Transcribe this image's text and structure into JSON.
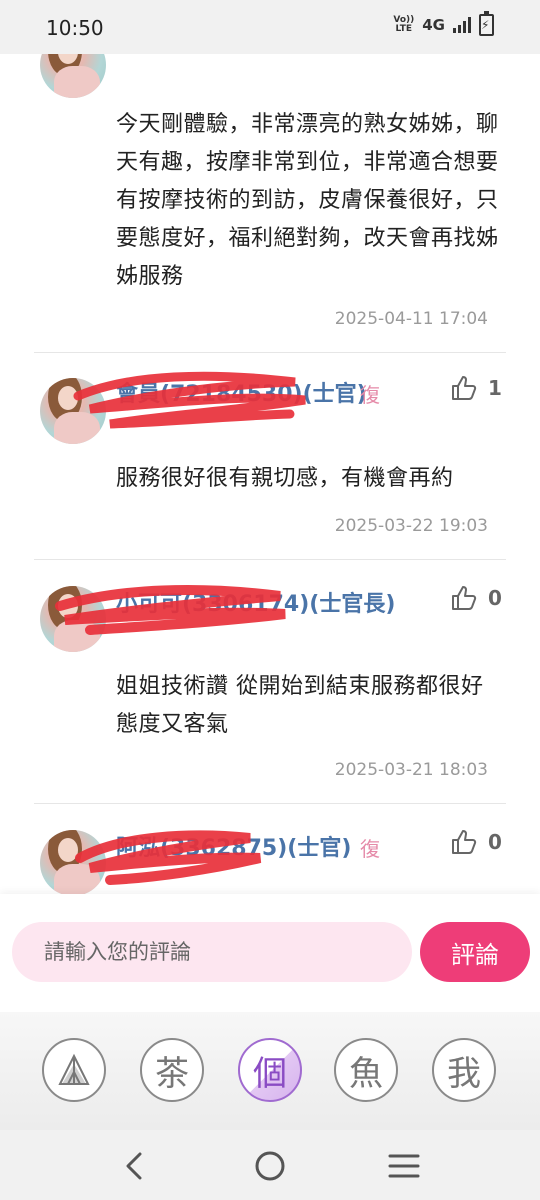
{
  "status": {
    "time": "10:50",
    "volte_top": "Vo))",
    "volte_bottom": "LTE",
    "network": "4G"
  },
  "comments": [
    {
      "text": "今天剛體驗，非常漂亮的熟女姊姊，聊天有趣，按摩非常到位，非常適合想要有按摩技術的到訪，皮膚保養很好，只要態度好，福利絕對夠，改天會再找姊姊服務",
      "time": "2025-04-11 17:04"
    },
    {
      "name": "會員(72184530)(士官)",
      "reply": "復",
      "likes": "1",
      "text": "服務很好很有親切感，有機會再約",
      "time": "2025-03-22 19:03"
    },
    {
      "name": "小可可(3306174)(士官長)",
      "likes": "0",
      "text": "姐姐技術讚 從開始到結束服務都很好 態度又客氣",
      "time": "2025-03-21 18:03"
    },
    {
      "name": "阿泓(3362875)(士官)",
      "reply": "復",
      "likes": "0"
    }
  ],
  "comment_input": {
    "placeholder": "請輸入您的評論",
    "button": "評論"
  },
  "bottom_nav": [
    {
      "label": "",
      "icon": "tent-icon"
    },
    {
      "label": "茶",
      "icon": "tea-icon"
    },
    {
      "label": "個",
      "icon": "personal-icon"
    },
    {
      "label": "魚",
      "icon": "fish-icon"
    },
    {
      "label": "我",
      "icon": "me-icon"
    }
  ],
  "colors": {
    "accent": "#ee3d78",
    "input_bg": "#fde6f0",
    "name": "#4a74a8",
    "active_nav": "#a06bd0"
  }
}
